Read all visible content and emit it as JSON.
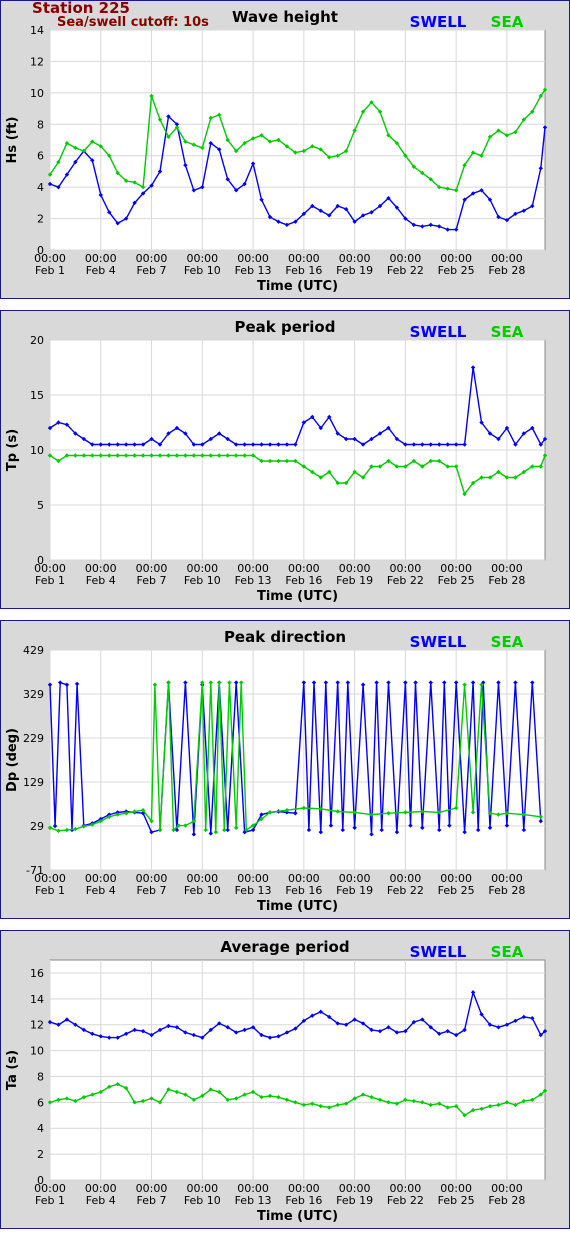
{
  "station": {
    "title": "Station 225",
    "subtitle": "Sea/swell cutoff: 10s"
  },
  "colors": {
    "swell": "#0000ff",
    "sea": "#00cc00",
    "station": "#8b0000",
    "frame": "#1a1a8a"
  },
  "legend": {
    "swell": "SWELL",
    "sea": "SEA"
  },
  "x_axis": {
    "label": "Time (UTC)",
    "tick_days": [
      1,
      4,
      7,
      10,
      13,
      16,
      19,
      22,
      25,
      28
    ],
    "tick_time": "00:00",
    "tick_dates": [
      "Feb 1",
      "Feb 4",
      "Feb 7",
      "Feb 10",
      "Feb 13",
      "Feb 16",
      "Feb 19",
      "Feb 22",
      "Feb 25",
      "Feb 28"
    ],
    "range": [
      "Feb 1 00:00",
      "Mar 1 06:00"
    ]
  },
  "chart_data": [
    {
      "type": "line",
      "title": "Wave height",
      "ylabel": "Hs (ft)",
      "ylim": [
        0,
        14
      ],
      "yticks": [
        0,
        2,
        4,
        6,
        8,
        10,
        12,
        14
      ],
      "grid": true,
      "legend_position": "top-right",
      "series": [
        {
          "name": "SWELL",
          "color": "#0000ff",
          "x": [
            1,
            1.5,
            2,
            2.5,
            3,
            3.5,
            4,
            4.5,
            5,
            5.5,
            6,
            6.5,
            7,
            7.5,
            8,
            8.5,
            9,
            9.5,
            10,
            10.5,
            11,
            11.5,
            12,
            12.5,
            13,
            13.5,
            14,
            14.5,
            15,
            15.5,
            16,
            16.5,
            17,
            17.5,
            18,
            18.5,
            19,
            19.5,
            20,
            20.5,
            21,
            21.5,
            22,
            22.5,
            23,
            23.5,
            24,
            24.5,
            25,
            25.5,
            26,
            26.5,
            27,
            27.5,
            28,
            28.5,
            29,
            29.5,
            30,
            30.25
          ],
          "y": [
            4.2,
            4.0,
            4.8,
            5.6,
            6.3,
            5.7,
            3.5,
            2.4,
            1.7,
            2.0,
            3.0,
            3.6,
            4.1,
            5.0,
            8.5,
            8.0,
            5.4,
            3.8,
            4.0,
            6.8,
            6.4,
            4.5,
            3.8,
            4.2,
            5.5,
            3.2,
            2.1,
            1.8,
            1.6,
            1.8,
            2.3,
            2.8,
            2.5,
            2.2,
            2.8,
            2.6,
            1.8,
            2.2,
            2.4,
            2.8,
            3.3,
            2.7,
            2.0,
            1.6,
            1.5,
            1.6,
            1.5,
            1.3,
            1.3,
            3.2,
            3.6,
            3.8,
            3.2,
            2.1,
            1.9,
            2.3,
            2.5,
            2.8,
            5.2,
            7.8
          ]
        },
        {
          "name": "SEA",
          "color": "#00cc00",
          "x": [
            1,
            1.5,
            2,
            2.5,
            3,
            3.5,
            4,
            4.5,
            5,
            5.5,
            6,
            6.5,
            7,
            7.5,
            8,
            8.5,
            9,
            9.5,
            10,
            10.5,
            11,
            11.5,
            12,
            12.5,
            13,
            13.5,
            14,
            14.5,
            15,
            15.5,
            16,
            16.5,
            17,
            17.5,
            18,
            18.5,
            19,
            19.5,
            20,
            20.5,
            21,
            21.5,
            22,
            22.5,
            23,
            23.5,
            24,
            24.5,
            25,
            25.5,
            26,
            26.5,
            27,
            27.5,
            28,
            28.5,
            29,
            29.5,
            30,
            30.25
          ],
          "y": [
            4.8,
            5.6,
            6.8,
            6.5,
            6.3,
            6.9,
            6.6,
            6.0,
            4.9,
            4.4,
            4.3,
            4.0,
            9.8,
            8.3,
            7.2,
            7.8,
            6.9,
            6.7,
            6.5,
            8.4,
            8.6,
            7.0,
            6.3,
            6.8,
            7.1,
            7.3,
            6.9,
            7.0,
            6.6,
            6.2,
            6.3,
            6.6,
            6.4,
            5.9,
            6.0,
            6.3,
            7.6,
            8.8,
            9.4,
            8.8,
            7.3,
            6.8,
            6.0,
            5.3,
            4.9,
            4.5,
            4.0,
            3.9,
            3.8,
            5.4,
            6.2,
            6.0,
            7.2,
            7.6,
            7.3,
            7.5,
            8.3,
            8.8,
            9.8,
            10.2
          ]
        }
      ]
    },
    {
      "type": "line",
      "title": "Peak period",
      "ylabel": "Tp (s)",
      "ylim": [
        0,
        20
      ],
      "yticks": [
        0,
        5,
        10,
        15,
        20
      ],
      "grid": true,
      "legend_position": "top-right",
      "series": [
        {
          "name": "SWELL",
          "color": "#0000ff",
          "x": [
            1,
            1.5,
            2,
            2.5,
            3,
            3.5,
            4,
            4.5,
            5,
            5.5,
            6,
            6.5,
            7,
            7.5,
            8,
            8.5,
            9,
            9.5,
            10,
            10.5,
            11,
            11.5,
            12,
            12.5,
            13,
            13.5,
            14,
            14.5,
            15,
            15.5,
            16,
            16.5,
            17,
            17.5,
            18,
            18.5,
            19,
            19.5,
            20,
            20.5,
            21,
            21.5,
            22,
            22.5,
            23,
            23.5,
            24,
            24.5,
            25,
            25.5,
            26,
            26.5,
            27,
            27.5,
            28,
            28.5,
            29,
            29.5,
            30,
            30.25
          ],
          "y": [
            12.0,
            12.5,
            12.3,
            11.5,
            11.0,
            10.5,
            10.5,
            10.5,
            10.5,
            10.5,
            10.5,
            10.5,
            11.0,
            10.5,
            11.5,
            12.0,
            11.5,
            10.5,
            10.5,
            11.0,
            11.5,
            11.0,
            10.5,
            10.5,
            10.5,
            10.5,
            10.5,
            10.5,
            10.5,
            10.5,
            12.5,
            13.0,
            12.0,
            13.0,
            11.5,
            11.0,
            11.0,
            10.5,
            11.0,
            11.5,
            12.0,
            11.0,
            10.5,
            10.5,
            10.5,
            10.5,
            10.5,
            10.5,
            10.5,
            10.5,
            17.5,
            12.5,
            11.5,
            11.0,
            12.0,
            10.5,
            11.5,
            12.0,
            10.5,
            11.0
          ]
        },
        {
          "name": "SEA",
          "color": "#00cc00",
          "x": [
            1,
            1.5,
            2,
            2.5,
            3,
            3.5,
            4,
            4.5,
            5,
            5.5,
            6,
            6.5,
            7,
            7.5,
            8,
            8.5,
            9,
            9.5,
            10,
            10.5,
            11,
            11.5,
            12,
            12.5,
            13,
            13.5,
            14,
            14.5,
            15,
            15.5,
            16,
            16.5,
            17,
            17.5,
            18,
            18.5,
            19,
            19.5,
            20,
            20.5,
            21,
            21.5,
            22,
            22.5,
            23,
            23.5,
            24,
            24.5,
            25,
            25.5,
            26,
            26.5,
            27,
            27.5,
            28,
            28.5,
            29,
            29.5,
            30,
            30.25
          ],
          "y": [
            9.5,
            9.0,
            9.5,
            9.5,
            9.5,
            9.5,
            9.5,
            9.5,
            9.5,
            9.5,
            9.5,
            9.5,
            9.5,
            9.5,
            9.5,
            9.5,
            9.5,
            9.5,
            9.5,
            9.5,
            9.5,
            9.5,
            9.5,
            9.5,
            9.5,
            9.0,
            9.0,
            9.0,
            9.0,
            9.0,
            8.5,
            8.0,
            7.5,
            8.0,
            7.0,
            7.0,
            8.0,
            7.5,
            8.5,
            8.5,
            9.0,
            8.5,
            8.5,
            9.0,
            8.5,
            9.0,
            9.0,
            8.5,
            8.5,
            6.0,
            7.0,
            7.5,
            7.5,
            8.0,
            7.5,
            7.5,
            8.0,
            8.5,
            8.5,
            9.5
          ]
        }
      ]
    },
    {
      "type": "scatter",
      "title": "Peak direction",
      "ylabel": "Dp (deg)",
      "ylim": [
        -71,
        429
      ],
      "yticks": [
        -71,
        29,
        129,
        229,
        329,
        429
      ],
      "grid": true,
      "legend_position": "top-right",
      "series": [
        {
          "name": "SWELL",
          "color": "#0000ff",
          "x": [
            1,
            1.3,
            1.6,
            2,
            2.3,
            2.6,
            3,
            3.5,
            4,
            4.5,
            5,
            5.5,
            6,
            6.5,
            7,
            7.5,
            8,
            8.5,
            9,
            9.5,
            10,
            10.5,
            11,
            11.5,
            12,
            12.5,
            13,
            13.5,
            14,
            14.5,
            15,
            15.5,
            16,
            16.3,
            16.6,
            17,
            17.3,
            17.6,
            18,
            18.3,
            18.6,
            19,
            19.5,
            20,
            20.3,
            20.6,
            21,
            21.5,
            22,
            22.3,
            22.6,
            23,
            23.5,
            24,
            24.3,
            24.6,
            25,
            25.5,
            26,
            26.3,
            26.6,
            27,
            27.5,
            28,
            28.5,
            29,
            29.5,
            30
          ],
          "y": [
            350,
            29,
            355,
            350,
            20,
            352,
            30,
            35,
            45,
            55,
            60,
            62,
            60,
            58,
            15,
            20,
            355,
            20,
            355,
            10,
            350,
            12,
            355,
            20,
            355,
            15,
            20,
            55,
            60,
            62,
            60,
            58,
            355,
            20,
            355,
            15,
            355,
            30,
            355,
            20,
            355,
            25,
            350,
            10,
            355,
            20,
            355,
            15,
            355,
            30,
            355,
            25,
            355,
            20,
            355,
            30,
            355,
            15,
            355,
            20,
            355,
            25,
            355,
            30,
            355,
            20,
            355,
            40
          ]
        },
        {
          "name": "SEA",
          "color": "#00cc00",
          "x": [
            1,
            1.5,
            2,
            2.5,
            3,
            3.5,
            4,
            4.5,
            5,
            5.5,
            6,
            6.5,
            7,
            7.2,
            7.5,
            8,
            8.3,
            8.6,
            9,
            9.5,
            10,
            10.2,
            10.5,
            10.8,
            11,
            11.3,
            11.6,
            12,
            12.3,
            12.6,
            13,
            13.5,
            14,
            15,
            16,
            17,
            18,
            19,
            20,
            21,
            22,
            23,
            24,
            25,
            25.5,
            26,
            26.5,
            27,
            27.5,
            28,
            29,
            30
          ],
          "y": [
            25,
            18,
            20,
            22,
            28,
            32,
            40,
            50,
            55,
            58,
            62,
            65,
            40,
            350,
            20,
            355,
            20,
            30,
            30,
            40,
            355,
            20,
            355,
            15,
            355,
            20,
            355,
            25,
            355,
            20,
            30,
            45,
            60,
            65,
            70,
            68,
            62,
            60,
            55,
            58,
            60,
            62,
            60,
            70,
            350,
            60,
            350,
            58,
            55,
            58,
            55,
            50
          ]
        }
      ]
    },
    {
      "type": "line",
      "title": "Average period",
      "ylabel": "Ta (s)",
      "ylim": [
        0,
        17
      ],
      "yticks": [
        0,
        2,
        4,
        6,
        8,
        10,
        12,
        14,
        16
      ],
      "grid": true,
      "legend_position": "top-right",
      "series": [
        {
          "name": "SWELL",
          "color": "#0000ff",
          "x": [
            1,
            1.5,
            2,
            2.5,
            3,
            3.5,
            4,
            4.5,
            5,
            5.5,
            6,
            6.5,
            7,
            7.5,
            8,
            8.5,
            9,
            9.5,
            10,
            10.5,
            11,
            11.5,
            12,
            12.5,
            13,
            13.5,
            14,
            14.5,
            15,
            15.5,
            16,
            16.5,
            17,
            17.5,
            18,
            18.5,
            19,
            19.5,
            20,
            20.5,
            21,
            21.5,
            22,
            22.5,
            23,
            23.5,
            24,
            24.5,
            25,
            25.5,
            26,
            26.5,
            27,
            27.5,
            28,
            28.5,
            29,
            29.5,
            30,
            30.25
          ],
          "y": [
            12.2,
            12.0,
            12.4,
            12.0,
            11.6,
            11.3,
            11.1,
            11.0,
            11.0,
            11.3,
            11.6,
            11.5,
            11.2,
            11.6,
            11.9,
            11.8,
            11.4,
            11.2,
            11.0,
            11.6,
            12.1,
            11.8,
            11.4,
            11.6,
            11.8,
            11.2,
            11.0,
            11.1,
            11.4,
            11.7,
            12.3,
            12.7,
            13.0,
            12.6,
            12.1,
            12.0,
            12.4,
            12.1,
            11.6,
            11.5,
            11.8,
            11.4,
            11.5,
            12.2,
            12.4,
            11.8,
            11.3,
            11.5,
            11.2,
            11.6,
            14.5,
            12.8,
            12.0,
            11.8,
            12.0,
            12.3,
            12.6,
            12.5,
            11.2,
            11.5
          ]
        },
        {
          "name": "SEA",
          "color": "#00cc00",
          "x": [
            1,
            1.5,
            2,
            2.5,
            3,
            3.5,
            4,
            4.5,
            5,
            5.5,
            6,
            6.5,
            7,
            7.5,
            8,
            8.5,
            9,
            9.5,
            10,
            10.5,
            11,
            11.5,
            12,
            12.5,
            13,
            13.5,
            14,
            14.5,
            15,
            15.5,
            16,
            16.5,
            17,
            17.5,
            18,
            18.5,
            19,
            19.5,
            20,
            20.5,
            21,
            21.5,
            22,
            22.5,
            23,
            23.5,
            24,
            24.5,
            25,
            25.5,
            26,
            26.5,
            27,
            27.5,
            28,
            28.5,
            29,
            29.5,
            30,
            30.25
          ],
          "y": [
            6.0,
            6.2,
            6.3,
            6.1,
            6.4,
            6.6,
            6.8,
            7.2,
            7.4,
            7.1,
            6.0,
            6.1,
            6.3,
            6.0,
            7.0,
            6.8,
            6.6,
            6.2,
            6.5,
            7.0,
            6.8,
            6.2,
            6.3,
            6.6,
            6.8,
            6.4,
            6.5,
            6.4,
            6.2,
            6.0,
            5.8,
            5.9,
            5.7,
            5.6,
            5.8,
            5.9,
            6.3,
            6.6,
            6.4,
            6.2,
            6.0,
            5.9,
            6.2,
            6.1,
            6.0,
            5.8,
            5.9,
            5.6,
            5.7,
            5.0,
            5.4,
            5.5,
            5.7,
            5.8,
            6.0,
            5.8,
            6.1,
            6.2,
            6.6,
            6.9
          ]
        }
      ]
    }
  ]
}
